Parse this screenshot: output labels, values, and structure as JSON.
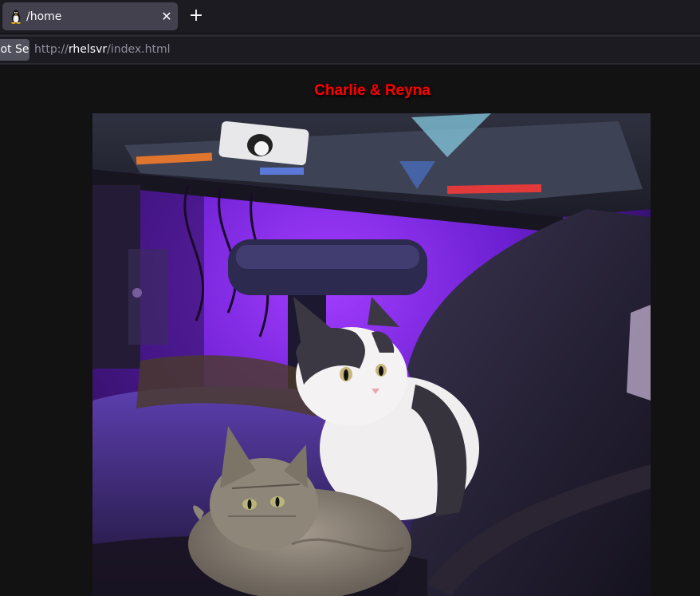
{
  "browser": {
    "tab": {
      "title": "/home",
      "icon": "tux-penguin-icon",
      "close_glyph": "✕"
    },
    "new_tab_glyph": "+",
    "address": {
      "security_label": "Not Secure",
      "scheme": "http://",
      "host": "rhelsvr",
      "path": "/index.html"
    }
  },
  "page": {
    "heading": "Charlie & Reyna",
    "photo": {
      "alt": "Charlie & Reyna",
      "description_icon": "cats-on-gaming-chair-photo"
    }
  },
  "colors": {
    "heading": "#ff0000",
    "background": "#121212",
    "accent_purple": "#7a22e0"
  }
}
